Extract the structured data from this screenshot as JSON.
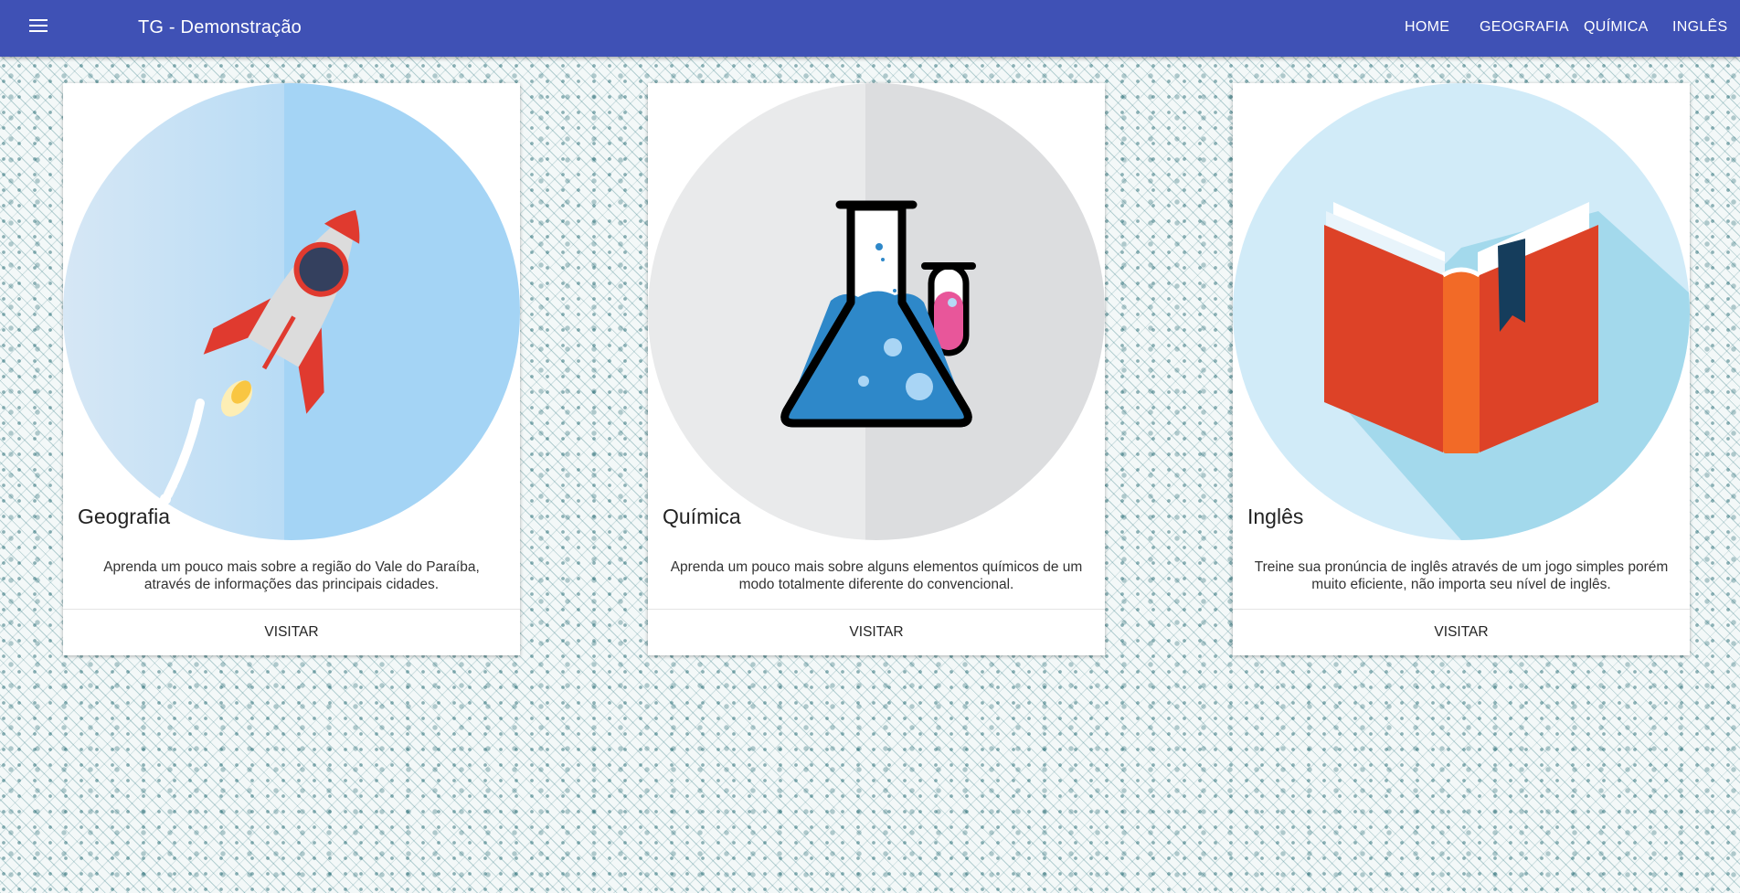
{
  "app": {
    "title": "TG - Demonstração"
  },
  "nav": {
    "home": "HOME",
    "geografia": "GEOGRAFIA",
    "quimica": "QUÍMICA",
    "ingles": "INGLÊS"
  },
  "cards": [
    {
      "title": "Geografia",
      "description": "Aprenda um pouco mais sobre a região do Vale do Paraíba, através de informações das principais cidades.",
      "action": "VISITAR",
      "image": "rocket-icon"
    },
    {
      "title": "Química",
      "description": "Aprenda um pouco mais sobre alguns elementos químicos de um modo totalmente diferente do convencional.",
      "action": "VISITAR",
      "image": "flask-icon"
    },
    {
      "title": "Inglês",
      "description": "Treine sua pronúncia de inglês através de um jogo simples porém muito eficiente, não importa seu nível de inglês.",
      "action": "VISITAR",
      "image": "book-icon"
    }
  ],
  "colors": {
    "appbar": "#3f51b5",
    "rocket_bg": "#a4d4f5",
    "flask_bg": "#dcdddf",
    "book_bg": "#d1ebf8",
    "book_red": "#dd4227"
  }
}
